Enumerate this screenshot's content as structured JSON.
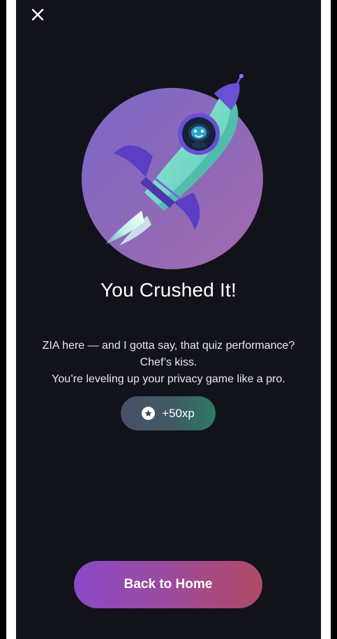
{
  "header": {
    "close_icon": "close-icon"
  },
  "hero": {
    "illustration": "rocket-with-robot-illustration"
  },
  "result": {
    "title": "You Crushed It!",
    "message_lines": [
      "ZIA here — and I gotta say, that quiz performance?",
      "Chef’s kiss.",
      "You’re leveling up your privacy game like a pro."
    ]
  },
  "reward": {
    "icon": "star-badge-icon",
    "label": "+50xp"
  },
  "actions": {
    "home_label": "Back to Home"
  },
  "colors": {
    "background": "#11121a",
    "button_gradient_start": "#8a4bc6",
    "button_gradient_end": "#b04a63",
    "pill_gradient_start": "#4b4f68",
    "pill_gradient_end": "#2f7a63"
  }
}
